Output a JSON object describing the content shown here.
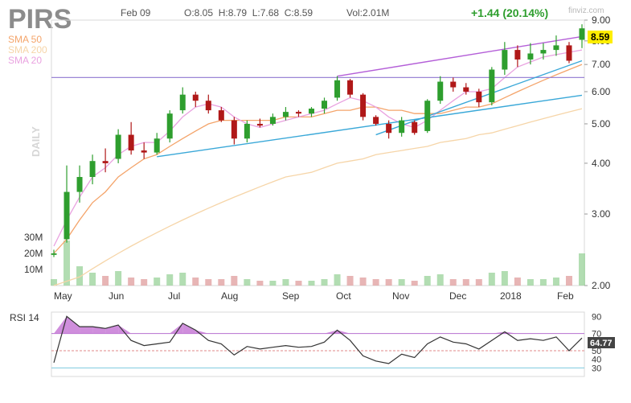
{
  "header": {
    "ticker": "PIRS",
    "date": "Feb 09",
    "ohlc": "O:8.05  H:8.79  L:7.68  C:8.59",
    "volume": "Vol:2.01M",
    "change": "+1.44 (20.14%)",
    "watermark": "finviz.com",
    "timeframe": "DAILY"
  },
  "legend": [
    {
      "label": "SMA 50",
      "color": "#f4a46a"
    },
    {
      "label": "SMA 200",
      "color": "#f6d5a8"
    },
    {
      "label": "SMA 20",
      "color": "#e9a2e0"
    }
  ],
  "colors": {
    "up": "#2e9e2e",
    "down": "#b01818",
    "trendline": "#3aa8d8",
    "channel": "#b45fd8",
    "hline": "#9b86d6",
    "rsi_line": "#333333",
    "rsi_fill": "#c77ad6",
    "price_badge": "#ffee00",
    "rsi_badge": "#444444"
  },
  "chart_data": [
    {
      "type": "candlestick",
      "ylim": [
        2.0,
        9.0
      ],
      "y_scale": "log",
      "y_ticks": [
        "9.00",
        "8.00",
        "7.00",
        "6.00",
        "5.00",
        "4.00",
        "3.00",
        "2.00"
      ],
      "x_ticks": [
        "May",
        "Jun",
        "Jul",
        "Aug",
        "Sep",
        "Oct",
        "Nov",
        "Dec",
        "2018",
        "Feb"
      ],
      "volume_ticks": [
        "30M",
        "20M",
        "10M"
      ],
      "last_price": "8.59",
      "grid": false,
      "candles": [
        {
          "date": "May 1",
          "open": 2.38,
          "high": 2.45,
          "low": 2.35,
          "close": 2.4
        },
        {
          "date": "May 8",
          "open": 2.6,
          "high": 3.95,
          "low": 2.55,
          "close": 3.4
        },
        {
          "date": "May 15",
          "open": 3.4,
          "high": 3.95,
          "low": 3.2,
          "close": 3.7
        },
        {
          "date": "May 22",
          "open": 3.7,
          "high": 4.2,
          "low": 3.55,
          "close": 4.05
        },
        {
          "date": "May 29",
          "open": 4.05,
          "high": 4.35,
          "low": 3.8,
          "close": 4.0
        },
        {
          "date": "Jun 5",
          "open": 4.1,
          "high": 4.85,
          "low": 4.0,
          "close": 4.7
        },
        {
          "date": "Jun 12",
          "open": 4.7,
          "high": 5.05,
          "low": 4.2,
          "close": 4.3
        },
        {
          "date": "Jun 19",
          "open": 4.3,
          "high": 4.5,
          "low": 4.1,
          "close": 4.25
        },
        {
          "date": "Jun 26",
          "open": 4.25,
          "high": 4.75,
          "low": 4.2,
          "close": 4.6
        },
        {
          "date": "Jul 3",
          "open": 4.6,
          "high": 5.4,
          "low": 4.5,
          "close": 5.3
        },
        {
          "date": "Jul 10",
          "open": 5.4,
          "high": 6.15,
          "low": 5.3,
          "close": 5.9
        },
        {
          "date": "Jul 17",
          "open": 5.9,
          "high": 6.0,
          "low": 5.5,
          "close": 5.7
        },
        {
          "date": "Jul 24",
          "open": 5.7,
          "high": 5.9,
          "low": 5.3,
          "close": 5.4
        },
        {
          "date": "Jul 31",
          "open": 5.4,
          "high": 5.5,
          "low": 5.05,
          "close": 5.1
        },
        {
          "date": "Aug 7",
          "open": 5.1,
          "high": 5.2,
          "low": 4.45,
          "close": 4.6
        },
        {
          "date": "Aug 14",
          "open": 4.6,
          "high": 5.1,
          "low": 4.5,
          "close": 5.0
        },
        {
          "date": "Aug 21",
          "open": 5.0,
          "high": 5.15,
          "low": 4.9,
          "close": 4.95
        },
        {
          "date": "Aug 28",
          "open": 5.0,
          "high": 5.3,
          "low": 4.95,
          "close": 5.2
        },
        {
          "date": "Sep 5",
          "open": 5.2,
          "high": 5.5,
          "low": 5.1,
          "close": 5.35
        },
        {
          "date": "Sep 11",
          "open": 5.35,
          "high": 5.4,
          "low": 5.2,
          "close": 5.3
        },
        {
          "date": "Sep 18",
          "open": 5.3,
          "high": 5.5,
          "low": 5.2,
          "close": 5.45
        },
        {
          "date": "Sep 25",
          "open": 5.45,
          "high": 5.8,
          "low": 5.3,
          "close": 5.7
        },
        {
          "date": "Oct 2",
          "open": 5.8,
          "high": 6.55,
          "low": 5.7,
          "close": 6.4
        },
        {
          "date": "Oct 9",
          "open": 6.4,
          "high": 6.45,
          "low": 5.8,
          "close": 5.9
        },
        {
          "date": "Oct 16",
          "open": 5.9,
          "high": 5.95,
          "low": 5.1,
          "close": 5.2
        },
        {
          "date": "Oct 23",
          "open": 5.2,
          "high": 5.25,
          "low": 4.95,
          "close": 5.0
        },
        {
          "date": "Oct 30",
          "open": 5.0,
          "high": 5.1,
          "low": 4.6,
          "close": 4.75
        },
        {
          "date": "Nov 6",
          "open": 4.75,
          "high": 5.2,
          "low": 4.65,
          "close": 5.1
        },
        {
          "date": "Nov 13",
          "open": 5.05,
          "high": 5.1,
          "low": 4.7,
          "close": 4.75
        },
        {
          "date": "Nov 20",
          "open": 4.8,
          "high": 5.75,
          "low": 4.75,
          "close": 5.7
        },
        {
          "date": "Nov 27",
          "open": 5.7,
          "high": 6.55,
          "low": 5.6,
          "close": 6.35
        },
        {
          "date": "Dec 4",
          "open": 6.35,
          "high": 6.5,
          "low": 6.0,
          "close": 6.15
        },
        {
          "date": "Dec 11",
          "open": 6.15,
          "high": 6.3,
          "low": 5.9,
          "close": 6.0
        },
        {
          "date": "Dec 18",
          "open": 6.0,
          "high": 6.1,
          "low": 5.5,
          "close": 5.65
        },
        {
          "date": "Dec 26",
          "open": 5.65,
          "high": 6.9,
          "low": 5.55,
          "close": 6.8
        },
        {
          "date": "Jan 2",
          "open": 6.8,
          "high": 7.95,
          "low": 6.6,
          "close": 7.6
        },
        {
          "date": "Jan 8",
          "open": 7.6,
          "high": 7.8,
          "low": 6.9,
          "close": 7.2
        },
        {
          "date": "Jan 15",
          "open": 7.2,
          "high": 7.9,
          "low": 7.0,
          "close": 7.45
        },
        {
          "date": "Jan 22",
          "open": 7.45,
          "high": 7.9,
          "low": 7.2,
          "close": 7.6
        },
        {
          "date": "Jan 29",
          "open": 7.6,
          "high": 8.25,
          "low": 7.35,
          "close": 7.8
        },
        {
          "date": "Feb 5",
          "open": 7.8,
          "high": 7.95,
          "low": 7.05,
          "close": 7.15
        },
        {
          "date": "Feb 9",
          "open": 8.05,
          "high": 8.79,
          "low": 7.68,
          "close": 8.59
        }
      ],
      "volume_millions": [
        4,
        28,
        12,
        8,
        6,
        9,
        5,
        4,
        5,
        7,
        8,
        5,
        4,
        4,
        6,
        4,
        3,
        3,
        4,
        3,
        3,
        4,
        7,
        6,
        5,
        4,
        4,
        4,
        3,
        6,
        7,
        4,
        4,
        4,
        8,
        9,
        5,
        4,
        4,
        5,
        6,
        20
      ],
      "sma20": [
        2.5,
        2.9,
        3.3,
        3.7,
        3.9,
        4.2,
        4.4,
        4.5,
        4.5,
        4.8,
        5.2,
        5.5,
        5.6,
        5.5,
        5.2,
        5.0,
        4.9,
        5.0,
        5.1,
        5.2,
        5.3,
        5.4,
        5.6,
        5.8,
        5.7,
        5.5,
        5.2,
        5.0,
        4.9,
        5.1,
        5.4,
        5.7,
        6.0,
        6.0,
        6.1,
        6.5,
        6.9,
        7.1,
        7.3,
        7.4,
        7.5,
        7.6
      ],
      "sma50": [
        2.4,
        2.6,
        2.9,
        3.2,
        3.4,
        3.7,
        3.9,
        4.1,
        4.2,
        4.4,
        4.6,
        4.8,
        5.0,
        5.1,
        5.1,
        5.1,
        5.1,
        5.1,
        5.2,
        5.2,
        5.2,
        5.3,
        5.4,
        5.4,
        5.5,
        5.5,
        5.4,
        5.4,
        5.3,
        5.3,
        5.3,
        5.4,
        5.5,
        5.5,
        5.6,
        5.8,
        6.0,
        6.2,
        6.4,
        6.6,
        6.8,
        7.0
      ],
      "sma200": [
        2.0,
        2.05,
        2.1,
        2.2,
        2.3,
        2.4,
        2.5,
        2.6,
        2.7,
        2.8,
        2.9,
        3.0,
        3.1,
        3.2,
        3.3,
        3.4,
        3.5,
        3.6,
        3.7,
        3.75,
        3.8,
        3.9,
        4.0,
        4.05,
        4.1,
        4.2,
        4.25,
        4.3,
        4.35,
        4.4,
        4.5,
        4.55,
        4.6,
        4.7,
        4.75,
        4.85,
        4.95,
        5.05,
        5.15,
        5.25,
        5.35,
        5.45
      ],
      "lines": [
        {
          "kind": "horizontal",
          "value": 6.5
        },
        {
          "kind": "trend",
          "from": {
            "i": 8,
            "v": 4.15
          },
          "to": {
            "i": 41,
            "v": 5.88
          }
        },
        {
          "kind": "trend",
          "from": {
            "i": 25,
            "v": 4.7
          },
          "to": {
            "i": 41,
            "v": 7.15
          }
        },
        {
          "kind": "channel",
          "from": {
            "i": 22,
            "v": 6.55
          },
          "to": {
            "i": 41,
            "v": 8.2
          }
        }
      ]
    },
    {
      "type": "line",
      "title": "RSI 14",
      "ylim": [
        20,
        95
      ],
      "y_ticks": [
        "90",
        "70",
        "50",
        "40",
        "30"
      ],
      "last_value": "64.77",
      "levels": [
        {
          "value": 70,
          "style": "overbought"
        },
        {
          "value": 50,
          "style": "mid"
        },
        {
          "value": 30,
          "style": "oversold"
        }
      ],
      "values": [
        36,
        90,
        78,
        78,
        76,
        80,
        62,
        56,
        58,
        60,
        82,
        74,
        62,
        58,
        45,
        55,
        52,
        54,
        56,
        54,
        55,
        60,
        74,
        62,
        44,
        38,
        35,
        46,
        42,
        58,
        66,
        60,
        58,
        52,
        62,
        72,
        62,
        64,
        62,
        66,
        50,
        64.77
      ]
    }
  ]
}
